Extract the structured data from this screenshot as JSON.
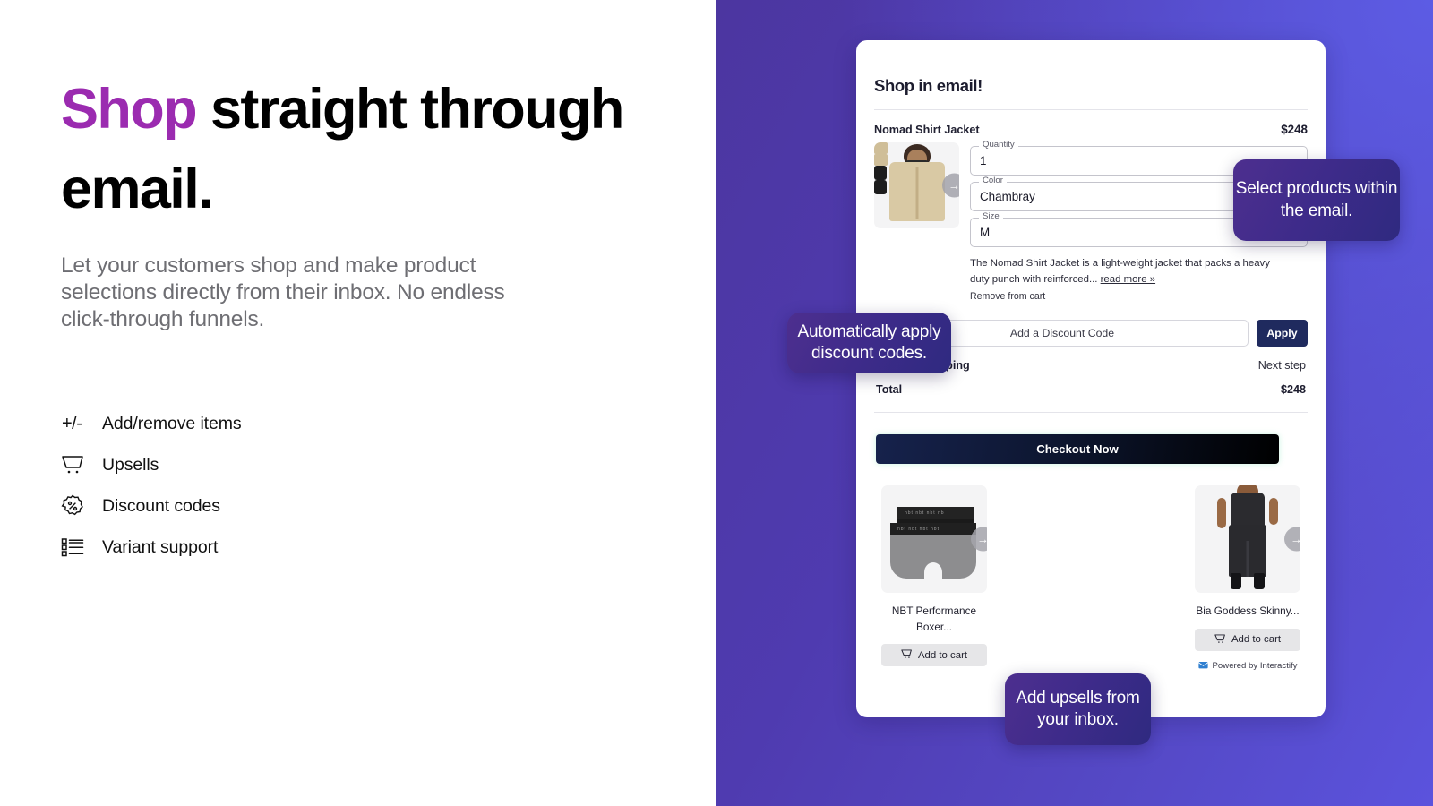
{
  "left": {
    "headline_accent": "Shop",
    "headline_rest": " straight through email.",
    "subhead": "Let your customers shop and make product selections directly from their inbox. No endless click-through funnels.",
    "features": [
      {
        "icon": "plus-minus-icon",
        "label": "Add/remove items"
      },
      {
        "icon": "shopping-cart-icon",
        "label": "Upsells"
      },
      {
        "icon": "percent-badge-icon",
        "label": "Discount codes"
      },
      {
        "icon": "variant-list-icon",
        "label": "Variant support"
      }
    ]
  },
  "email": {
    "title": "Shop in email!",
    "product": {
      "name": "Nomad Shirt Jacket",
      "price": "$248",
      "image_alt": "nomad-shirt-jacket-photo",
      "next_image_icon": "arrow-right-icon",
      "fields": [
        {
          "legend": "Quantity",
          "value": "1"
        },
        {
          "legend": "Color",
          "value": "Chambray"
        },
        {
          "legend": "Size",
          "value": "M"
        }
      ],
      "description": "The Nomad Shirt Jacket is a light-weight jacket that packs a heavy duty punch with reinforced...",
      "read_more": "read more »",
      "remove": "Remove from cart"
    },
    "discount": {
      "placeholder": "Add a Discount Code",
      "apply_label": "Apply"
    },
    "summary": [
      {
        "label": "Taxes & Shipping",
        "value": "Next step",
        "bold_value": false
      },
      {
        "label": "Total",
        "value": "$248",
        "bold_value": true
      }
    ],
    "checkout_label": "Checkout Now",
    "upsells": [
      {
        "name": "NBT Performance Boxer...",
        "image_alt": "nbt-performance-boxer-photo",
        "add_label": "Add to cart",
        "cart_icon": "shopping-cart-icon",
        "next_image_icon": "arrow-right-icon"
      },
      {
        "name": "Bia Goddess Skinny...",
        "image_alt": "bia-goddess-skinny-jeans-photo",
        "add_label": "Add to cart",
        "cart_icon": "shopping-cart-icon",
        "next_image_icon": "arrow-right-icon"
      }
    ],
    "powered_by": "Powered by Interactify",
    "powered_icon": "envelope-icon"
  },
  "callouts": {
    "select": "Select products within the email.",
    "discount": "Automatically apply discount codes.",
    "upsells": "Add upsells from your inbox."
  },
  "colors": {
    "accent_purple": "#9B2BB0",
    "panel_gradient_start": "#4c36a0",
    "panel_gradient_end": "#5b53dd",
    "callout_gradient_start": "#4d2f8f",
    "callout_gradient_end": "#2f2a80",
    "apply_button": "#1f2a5e",
    "checkout_button": "#0d1630"
  }
}
